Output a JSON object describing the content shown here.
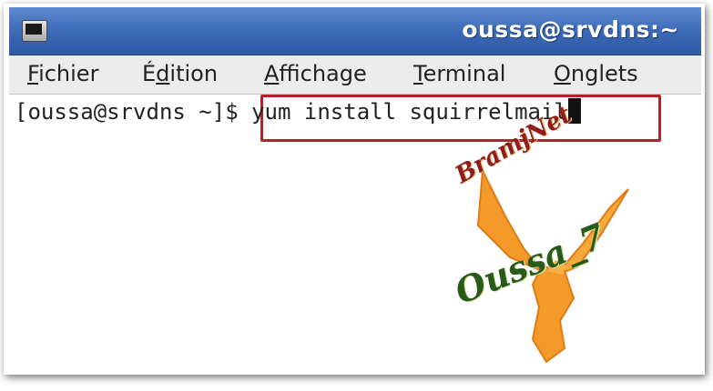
{
  "window": {
    "title": "oussa@srvdns:~",
    "icon": "terminal-icon"
  },
  "menubar": {
    "items": [
      {
        "label_prefix": "",
        "mnemonic": "F",
        "label_rest": "ichier"
      },
      {
        "label_prefix": "É",
        "mnemonic": "d",
        "label_rest": "ition"
      },
      {
        "label_prefix": "",
        "mnemonic": "A",
        "label_rest": "ffichage"
      },
      {
        "label_prefix": "",
        "mnemonic": "T",
        "label_rest": "erminal"
      },
      {
        "label_prefix": "",
        "mnemonic": "O",
        "label_rest": "nglets"
      }
    ]
  },
  "terminal": {
    "prompt": "[oussa@srvdns ~]$ ",
    "command": "yum install squirrelmail"
  },
  "watermark": {
    "text_top": "BramjNet",
    "text_bottom": "Oussa_7"
  },
  "colors": {
    "titlebar": "#3a68b6",
    "highlight_border": "#b0232a",
    "watermark_bird": "#f39a2a"
  }
}
